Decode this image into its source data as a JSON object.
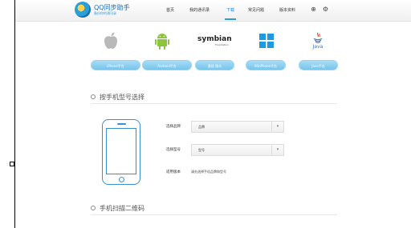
{
  "header": {
    "brand": "QQ同步助手",
    "brand_sub": "备份你的通讯录",
    "nav": [
      {
        "label": "首页"
      },
      {
        "label": "我的通讯录"
      },
      {
        "label": "下载"
      },
      {
        "label": "常见问题"
      },
      {
        "label": "版本资料"
      }
    ],
    "active_nav": "下载"
  },
  "platforms": [
    {
      "name": "iPhone",
      "icon": "apple-icon",
      "button": "iPhone平台"
    },
    {
      "name": "Android",
      "icon": "android-icon",
      "button": "Android平台"
    },
    {
      "name": "Symbian",
      "icon": "symbian-icon",
      "logo_text": "symbian",
      "logo_sub": "Foundation",
      "button": "塞班   版本"
    },
    {
      "name": "Windows Phone",
      "icon": "windows-icon",
      "button": "WinPhone平台"
    },
    {
      "name": "Java",
      "icon": "java-icon",
      "logo_text": "Java",
      "button": "Java平台"
    }
  ],
  "section1": {
    "title": "按手机型号选择"
  },
  "form": {
    "brand_label": "选择品牌",
    "brand_value": "品牌",
    "model_label": "选择型号",
    "model_value": "型号",
    "version_label": "适用版本",
    "version_value": "请先选择手机品牌和型号"
  },
  "section2": {
    "title": "手机扫描二维码"
  },
  "colors": {
    "accent": "#2a9fd8",
    "button": "#79c5ec"
  }
}
